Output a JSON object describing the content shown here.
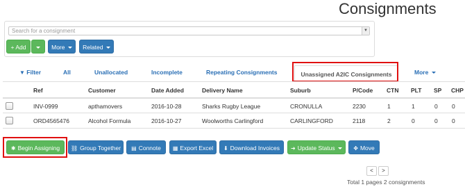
{
  "page_title": "Consignments",
  "search": {
    "placeholder": "Search for a consignment"
  },
  "toolbar": {
    "add_label": "Add",
    "more_label": "More",
    "related_label": "Related"
  },
  "tabs": {
    "filter": "Filter",
    "all": "All",
    "unallocated": "Unallocated",
    "incomplete": "Incomplete",
    "repeating": "Repeating Consignments",
    "unassigned": "Unassigned A2IC Consignments",
    "more": "More"
  },
  "table": {
    "headers": [
      "Ref",
      "Customer",
      "Date Added",
      "Delivery Name",
      "Suburb",
      "P/Code",
      "CTN",
      "PLT",
      "SP",
      "CHP"
    ],
    "rows": [
      [
        "INV-0999",
        "apthamovers",
        "2016-10-28",
        "Sharks Rugby League",
        "CRONULLA",
        "2230",
        "1",
        "1",
        "0",
        "0"
      ],
      [
        "ORD4565476",
        "Alcohol Formula",
        "2016-10-27",
        "Woolworths Carlingford",
        "CARLINGFORD",
        "2118",
        "2",
        "0",
        "0",
        "0"
      ]
    ]
  },
  "actions": {
    "begin_assigning": "Begin Assigning",
    "group_together": "Group Together",
    "connote": "Connote",
    "export_excel": "Export Excel",
    "download_invoices": "Download Invoices",
    "update_status": "Update Status",
    "move": "Move"
  },
  "pagination": {
    "prev": "<",
    "next": ">",
    "info": "Total 1 pages 2 consignments"
  },
  "colors": {
    "green": "#5cb85c",
    "blue": "#337ab7",
    "highlight": "#e01010",
    "link": "#2a6fb5"
  }
}
